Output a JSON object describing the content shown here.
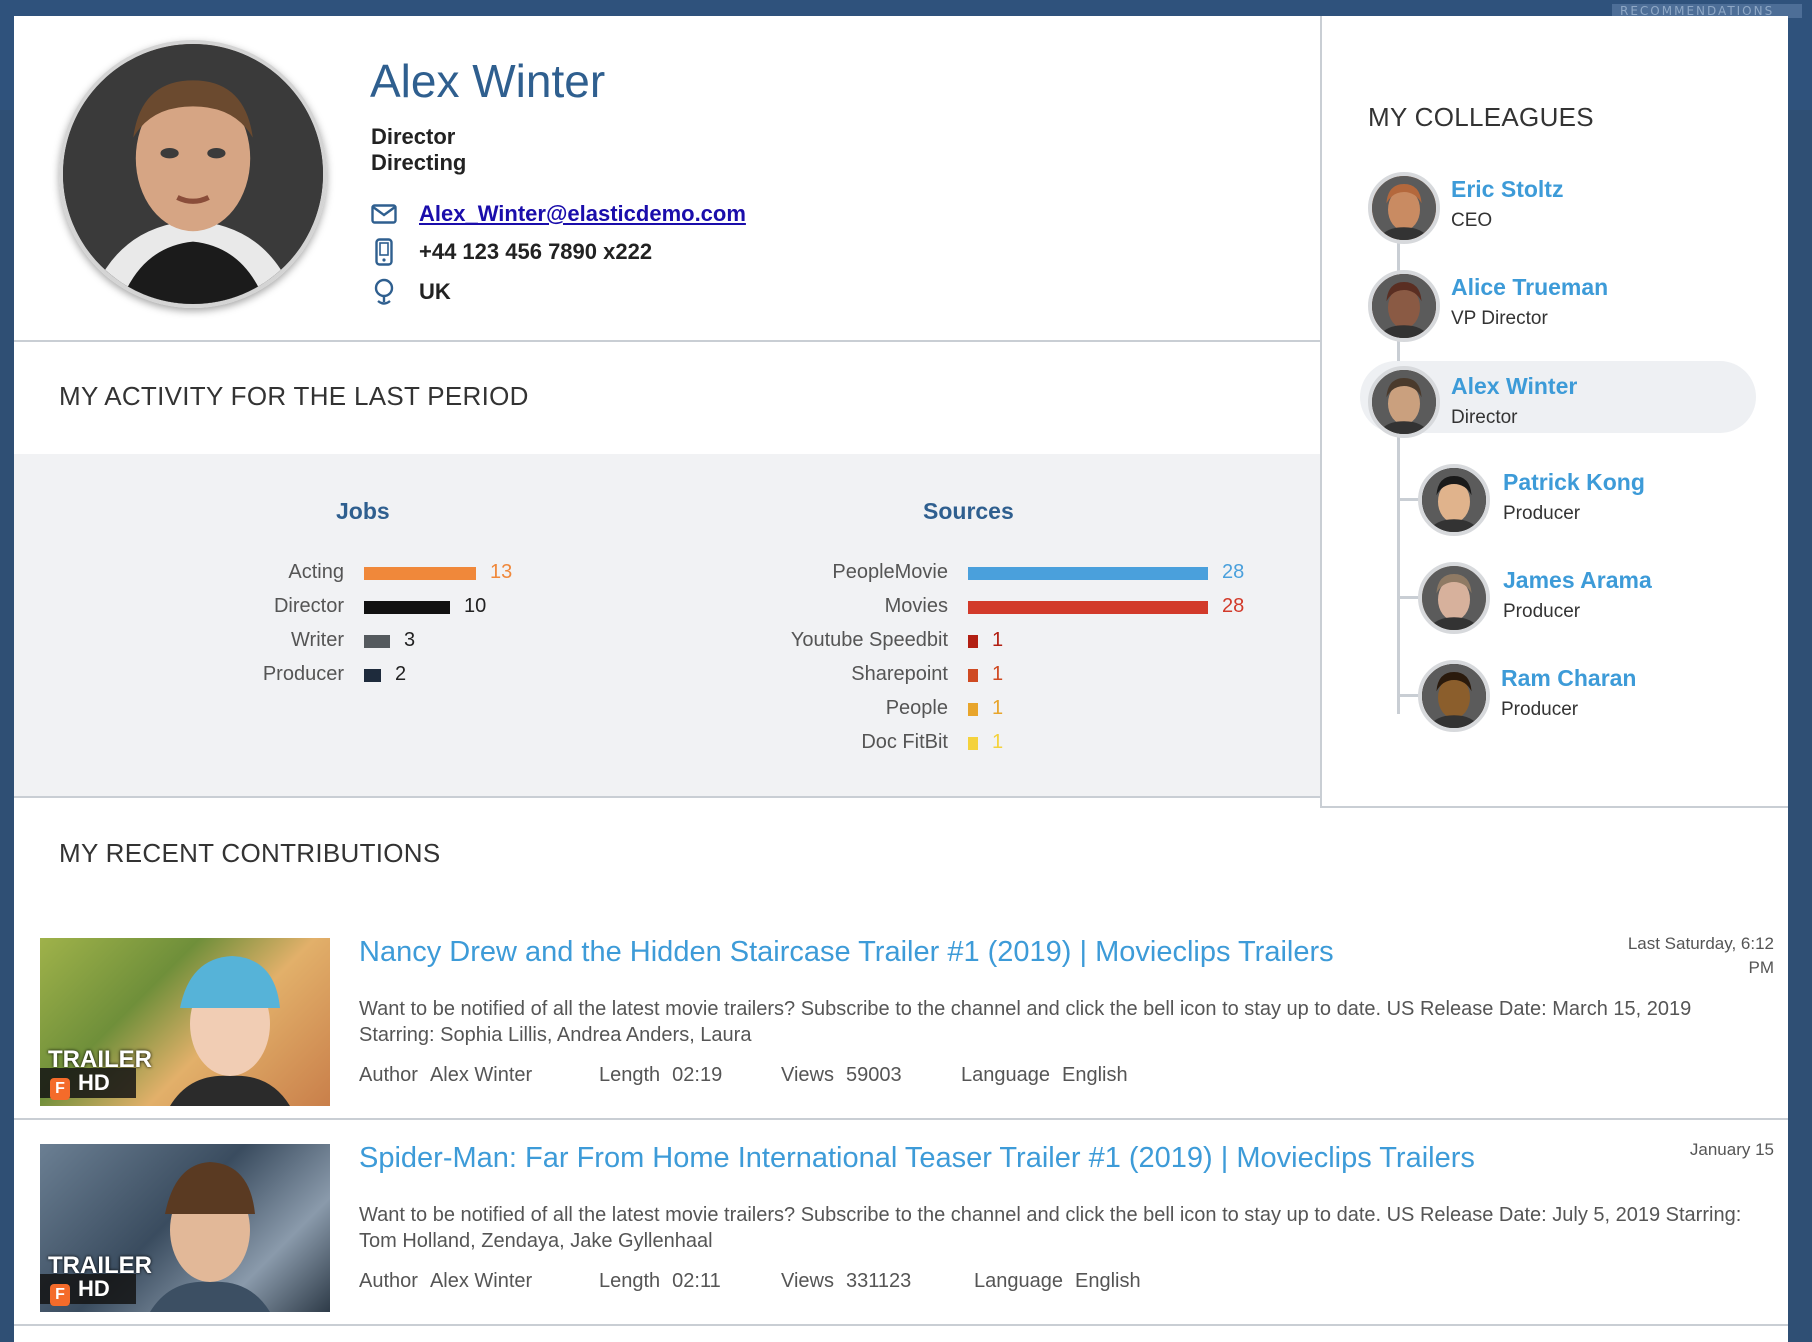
{
  "topbar": {
    "tab_label": "RECOMMENDATIONS"
  },
  "profile": {
    "name": "Alex Winter",
    "title": "Director",
    "department": "Directing",
    "email": "Alex_Winter@elasticdemo.com",
    "phone": "+44 123 456 7890 x222",
    "location": "UK"
  },
  "activity": {
    "section_title": "MY ACTIVITY FOR THE LAST PERIOD",
    "jobs": {
      "heading": "Jobs",
      "items": [
        {
          "label": "Acting",
          "value": "13",
          "color": "#f0883a"
        },
        {
          "label": "Director",
          "value": "10",
          "color": "#111111"
        },
        {
          "label": "Writer",
          "value": "3",
          "color": "#555a5e"
        },
        {
          "label": "Producer",
          "value": "2",
          "color": "#1e2b3c"
        }
      ]
    },
    "sources": {
      "heading": "Sources",
      "items": [
        {
          "label": "PeopleMovie",
          "value": "28",
          "color": "#4aa0dc"
        },
        {
          "label": "Movies",
          "value": "28",
          "color": "#d23a2a"
        },
        {
          "label": "Youtube Speedbit",
          "value": "1",
          "color": "#b21f12"
        },
        {
          "label": "Sharepoint",
          "value": "1",
          "color": "#cf4a22"
        },
        {
          "label": "People",
          "value": "1",
          "color": "#e8a52b"
        },
        {
          "label": "Doc FitBit",
          "value": "1",
          "color": "#f4d23c"
        }
      ]
    }
  },
  "colleagues": {
    "section_title": "MY COLLEAGUES",
    "items": [
      {
        "name": "Eric Stoltz",
        "role": "CEO"
      },
      {
        "name": "Alice Trueman",
        "role": "VP Director"
      },
      {
        "name": "Alex Winter",
        "role": "Director"
      },
      {
        "name": "Patrick Kong",
        "role": "Producer"
      },
      {
        "name": "James Arama",
        "role": "Producer"
      },
      {
        "name": "Ram Charan",
        "role": "Producer"
      }
    ]
  },
  "contributions": {
    "section_title": "MY RECENT CONTRIBUTIONS",
    "items": [
      {
        "title": "Nancy Drew and the Hidden Staircase Trailer #1 (2019) | Movieclips Trailers",
        "date_line1": "Last Saturday, 6:12",
        "date_line2": "PM",
        "description": "Want to be notified of all the latest movie trailers? Subscribe to the channel and click the bell icon to stay up to date. US Release Date: March 15, 2019 Starring: Sophia Lillis, Andrea Anders, Laura",
        "author_label": "Author",
        "author": "Alex Winter",
        "length_label": "Length",
        "length": "02:19",
        "views_label": "Views",
        "views": "59003",
        "language_label": "Language",
        "language": "English",
        "thumb_tag": "TRAILER",
        "thumb_hd": "HD"
      },
      {
        "title": "Spider-Man: Far From Home International Teaser Trailer #1 (2019) | Movieclips Trailers",
        "date_line1": "January 15",
        "date_line2": "",
        "description": "Want to be notified of all the latest movie trailers? Subscribe to the channel and click the bell icon to stay up to date. US Release Date: July 5, 2019 Starring: Tom Holland, Zendaya, Jake Gyllenhaal",
        "author_label": "Author",
        "author": "Alex Winter",
        "length_label": "Length",
        "length": "02:11",
        "views_label": "Views",
        "views": "331123",
        "language_label": "Language",
        "language": "English",
        "thumb_tag": "TRAILER",
        "thumb_hd": "HD"
      }
    ]
  }
}
